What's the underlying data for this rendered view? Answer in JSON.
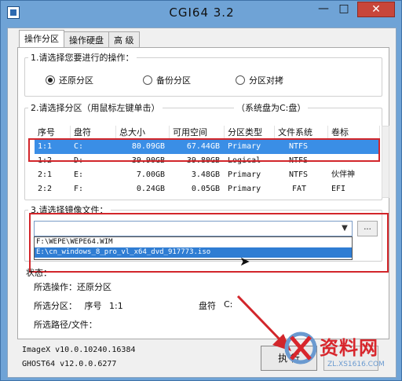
{
  "window": {
    "title": "CGI64  3.2",
    "min": "—",
    "max": "□",
    "close": "✕"
  },
  "tabs": [
    {
      "label": "操作分区"
    },
    {
      "label": "操作硬盘"
    },
    {
      "label": "高 级"
    }
  ],
  "operation": {
    "label": "1.请选择您要进行的操作：",
    "options": [
      {
        "label": "还原分区",
        "selected": true
      },
      {
        "label": "备份分区",
        "selected": false
      },
      {
        "label": "分区对拷",
        "selected": false
      }
    ]
  },
  "partition": {
    "label": "2.请选择分区（用鼠标左键单击）",
    "system_note": "（系统盘为C:盘）",
    "headers": [
      "序号",
      "盘符",
      "总大小",
      "可用空间",
      "分区类型",
      "文件系统",
      "卷标"
    ],
    "rows": [
      [
        "1:1",
        "C:",
        "80.09GB",
        "67.44GB",
        "Primary",
        "NTFS",
        ""
      ],
      [
        "1:2",
        "D:",
        "39.90GB",
        "39.80GB",
        "Logical",
        "NTFS",
        ""
      ],
      [
        "2:1",
        "E:",
        "7.00GB",
        "3.48GB",
        "Primary",
        "NTFS",
        "伙伴神"
      ],
      [
        "2:2",
        "F:",
        "0.24GB",
        "0.05GB",
        "Primary",
        "FAT",
        "EFI"
      ]
    ],
    "selected_row": 0
  },
  "image": {
    "label": "3.请选择镜像文件：",
    "value": "",
    "browse": "...",
    "options": [
      "F:\\WEPE\\WEPE64.WIM",
      "E:\\cn_windows_8_pro_vl_x64_dvd_917773.iso"
    ],
    "highlighted_option": 1
  },
  "status": {
    "heading": "状态：",
    "op_label": "所选操作：",
    "op_value": "还原分区",
    "part_label": "所选分区：",
    "seq_label": "序号",
    "seq_value": "1:1",
    "drive_label": "盘符",
    "drive_value": "C:",
    "path_label": "所选路径/文件：",
    "path_value": ""
  },
  "footer": {
    "imagex": "ImageX v10.0.10240.16384",
    "ghost": "GHOST64 v12.0.0.6277"
  },
  "buttons": {
    "execute": "执 行"
  },
  "watermark": {
    "text": "资料网",
    "sub": "ZL.XS1616.COM"
  },
  "colors": {
    "highlight": "#3a8ee6",
    "annotation": "#d2262b"
  }
}
